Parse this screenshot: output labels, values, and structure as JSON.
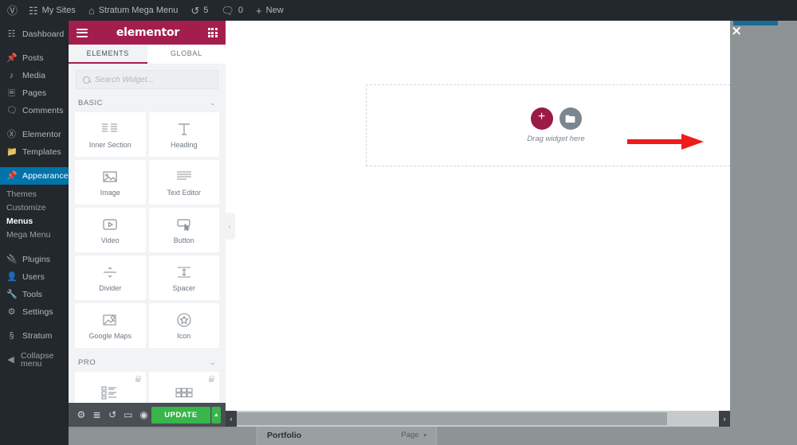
{
  "adminbar": {
    "wp_icon": "wordpress-icon",
    "items": [
      {
        "icon": "sites-icon",
        "label": "My Sites"
      },
      {
        "icon": "home-icon",
        "label": "Stratum Mega Menu"
      },
      {
        "icon": "refresh-icon",
        "label": "5"
      },
      {
        "icon": "comment-icon",
        "label": "0"
      },
      {
        "icon": "plus-icon",
        "label": "New"
      }
    ]
  },
  "sidebar": {
    "items": [
      {
        "icon": "dashboard-icon",
        "label": "Dashboard",
        "state": "normal"
      },
      {
        "icon": "pin-icon",
        "label": "Posts",
        "state": "gap"
      },
      {
        "icon": "media-icon",
        "label": "Media",
        "state": "normal"
      },
      {
        "icon": "pages-icon",
        "label": "Pages",
        "state": "normal"
      },
      {
        "icon": "comments-icon",
        "label": "Comments",
        "state": "normal"
      },
      {
        "icon": "elementor-icon",
        "label": "Elementor",
        "state": "gap"
      },
      {
        "icon": "templates-icon",
        "label": "Templates",
        "state": "normal"
      },
      {
        "icon": "appearance-icon",
        "label": "Appearance",
        "state": "current"
      }
    ],
    "submenu": [
      {
        "label": "Themes",
        "active": false
      },
      {
        "label": "Customize",
        "active": false
      },
      {
        "label": "Menus",
        "active": true
      },
      {
        "label": "Mega Menu",
        "active": false
      }
    ],
    "items2": [
      {
        "icon": "plugins-icon",
        "label": "Plugins",
        "state": "gap"
      },
      {
        "icon": "users-icon",
        "label": "Users",
        "state": "normal"
      },
      {
        "icon": "tools-icon",
        "label": "Tools",
        "state": "normal"
      },
      {
        "icon": "settings-icon",
        "label": "Settings",
        "state": "normal"
      },
      {
        "icon": "stratum-icon",
        "label": "Stratum",
        "state": "gap"
      },
      {
        "icon": "collapse-icon",
        "label": "Collapse menu",
        "state": "gap"
      }
    ]
  },
  "editor": {
    "logo": "elementor",
    "menu_icon": "hamburger-icon",
    "grid_icon": "grid-icon",
    "tabs": [
      {
        "label": "ELEMENTS",
        "active": true
      },
      {
        "label": "GLOBAL",
        "active": false
      }
    ],
    "search": {
      "placeholder": "Search Widget...",
      "value": "",
      "icon": "search-icon"
    },
    "categories": [
      {
        "name": "BASIC",
        "chevron": "⌄",
        "widgets": [
          {
            "label": "Inner Section",
            "icon": "inner-section-icon",
            "locked": false
          },
          {
            "label": "Heading",
            "icon": "heading-icon",
            "locked": false
          },
          {
            "label": "Image",
            "icon": "image-icon",
            "locked": false
          },
          {
            "label": "Text Editor",
            "icon": "text-editor-icon",
            "locked": false
          },
          {
            "label": "Video",
            "icon": "video-icon",
            "locked": false
          },
          {
            "label": "Button",
            "icon": "button-icon",
            "locked": false
          },
          {
            "label": "Divider",
            "icon": "divider-icon",
            "locked": false
          },
          {
            "label": "Spacer",
            "icon": "spacer-icon",
            "locked": false
          },
          {
            "label": "Google Maps",
            "icon": "google-maps-icon",
            "locked": false
          },
          {
            "label": "Icon",
            "icon": "star-icon",
            "locked": false
          }
        ]
      },
      {
        "name": "PRO",
        "chevron": "⌄",
        "widgets": [
          {
            "label": "",
            "icon": "posts-list-icon",
            "locked": true
          },
          {
            "label": "",
            "icon": "grid-widget-icon",
            "locked": true
          }
        ]
      }
    ],
    "footer": {
      "icons": [
        {
          "name": "settings-gear-icon",
          "glyph": "⚙"
        },
        {
          "name": "navigator-layers-icon",
          "glyph": "≣"
        },
        {
          "name": "history-icon",
          "glyph": "↺"
        },
        {
          "name": "responsive-mode-icon",
          "glyph": "▭"
        },
        {
          "name": "preview-eye-icon",
          "glyph": "◉"
        }
      ],
      "update_label": "UPDATE",
      "update_caret": "▲"
    },
    "collapse_handle": "‹"
  },
  "canvas": {
    "drop_zone": {
      "add_icon": "plus-icon",
      "folder_icon": "folder-icon",
      "text": "Drag widget here"
    },
    "annotation": {
      "type": "arrow",
      "color": "#ee1b1b",
      "points_to": "add-section-button"
    }
  },
  "scrollbar": {
    "left_arrow": "‹",
    "right_arrow": "›"
  },
  "portfolio": {
    "title": "Portfolio",
    "type_label": "Page",
    "caret": "▾"
  },
  "modal": {
    "close_icon": "×"
  },
  "colors": {
    "elementor_accent": "#a41e4d",
    "update_green": "#39b54a",
    "wp_admin_dark": "#23282d",
    "wp_active_blue": "#0073aa",
    "annotation_red": "#ee1b1b",
    "panel_bg": "#f1f3f5",
    "page_backdrop": "#8e9496"
  }
}
